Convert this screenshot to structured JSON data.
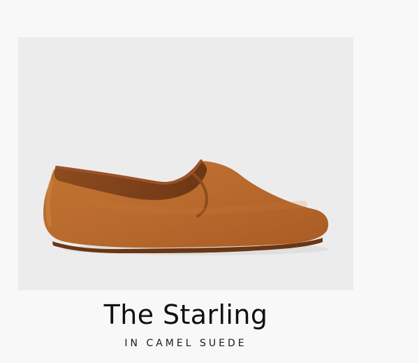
{
  "product": {
    "title": "The Starling",
    "subtitle": "IN CAMEL SUEDE",
    "image_subject": "shoe-image",
    "colors": {
      "panel_background": "#ececec",
      "page_background": "#f8f8f8",
      "suede": "#b96a2d",
      "suede_shadow": "#8f4b1b",
      "sole": "#6a3614",
      "text": "#111111"
    }
  }
}
